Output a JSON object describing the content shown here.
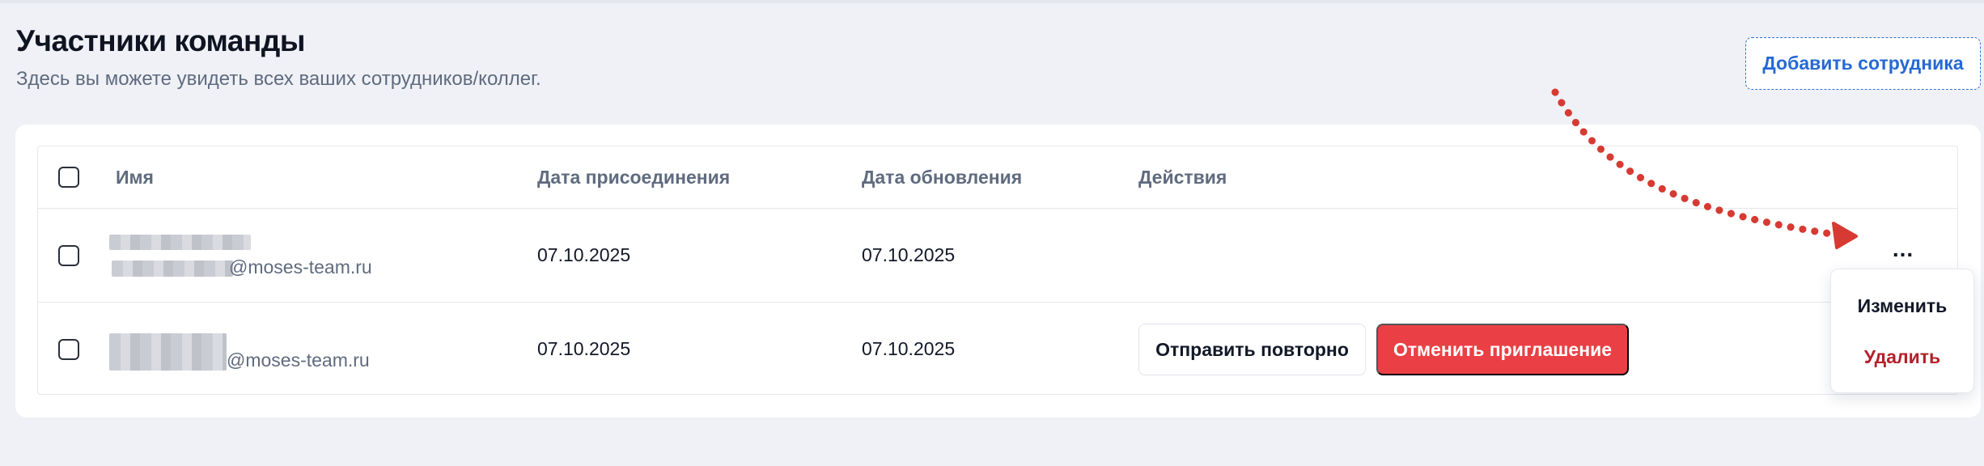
{
  "header": {
    "title": "Участники команды",
    "subtitle": "Здесь вы можете увидеть всех ваших сотрудников/коллег.",
    "add_button": "Добавить сотрудника"
  },
  "table": {
    "columns": [
      "Имя",
      "Дата присоединения",
      "Дата обновления",
      "Действия"
    ],
    "rows": [
      {
        "email_suffix": "@moses-team.ru",
        "joined": "07.10.2025",
        "updated": "07.10.2025",
        "more_label": "..."
      },
      {
        "email_suffix": "@moses-team.ru",
        "joined": "07.10.2025",
        "updated": "07.10.2025",
        "resend_label": "Отправить повторно",
        "cancel_label": "Отменить приглашение"
      }
    ]
  },
  "row_menu": {
    "items": [
      "Изменить",
      "Удалить"
    ]
  },
  "colors": {
    "accent_blue": "#2569d4",
    "danger_red": "#ea4045",
    "delete_text": "#b3202a",
    "annotation_arrow": "#d63a32"
  }
}
